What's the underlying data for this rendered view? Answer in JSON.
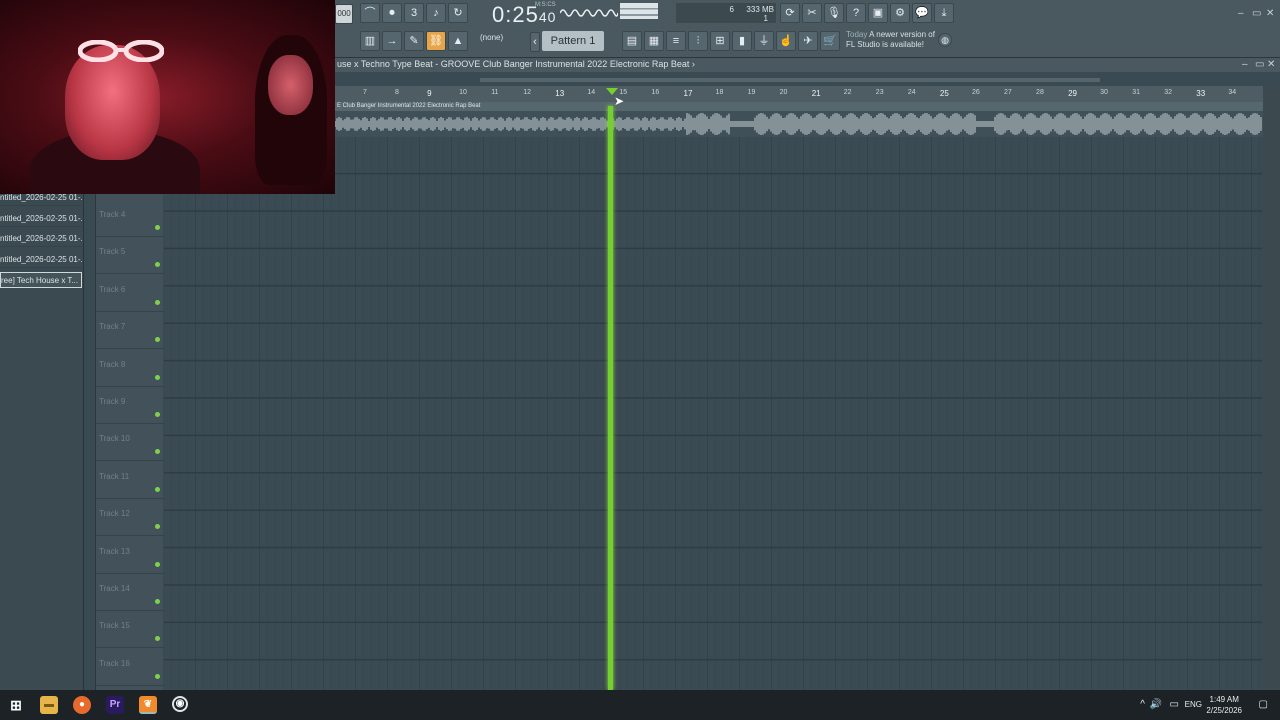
{
  "toolbar": {
    "tempo_fragment": "000",
    "time_main": "0:25",
    "time_sub": "40",
    "time_format": "M:S:CS",
    "cpu_voices": "6",
    "memory": "333 MB",
    "polyphony": "1",
    "pattern_none": "(none)",
    "pattern_name": "Pattern 1",
    "update_hint_day": "Today",
    "update_hint_text": "A newer version of",
    "update_hint_text2": "FL Studio is available!"
  },
  "playlist": {
    "title": "use x Techno Type Beat - GROOVE  Club Banger Instrumental 2022  Electronic Rap Beat ›",
    "clip_name": "E  Club Banger Instrumental 2022  Electronic Rap Beat",
    "ruler_ticks": [
      "7",
      "8",
      "9",
      "10",
      "11",
      "12",
      "13",
      "14",
      "15",
      "16",
      "17",
      "18",
      "19",
      "20",
      "21",
      "22",
      "23",
      "24",
      "25",
      "26",
      "27",
      "28",
      "29",
      "30",
      "31",
      "32",
      "33",
      "34"
    ],
    "big_ticks": [
      "9",
      "13",
      "17",
      "21",
      "25",
      "29",
      "33"
    ]
  },
  "browser": {
    "items": [
      "ntitled_2026-02-25 01-...",
      "ntitled_2026-02-25 01-...",
      "ntitled_2026-02-25 01-...",
      "ntitled_2026-02-25 01-...",
      "ree] Tech House x T..."
    ]
  },
  "tracks": [
    "Track 4",
    "Track 5",
    "Track 6",
    "Track 7",
    "Track 8",
    "Track 9",
    "Track 10",
    "Track 11",
    "Track 12",
    "Track 13",
    "Track 14",
    "Track 15",
    "Track 16"
  ],
  "taskbar": {
    "lang": "ENG",
    "time": "1:49 AM",
    "date": "2/25/2026"
  },
  "colors": {
    "playhead": "#74d12d",
    "accent": "#e7a54a",
    "background": "#3b4b53"
  }
}
